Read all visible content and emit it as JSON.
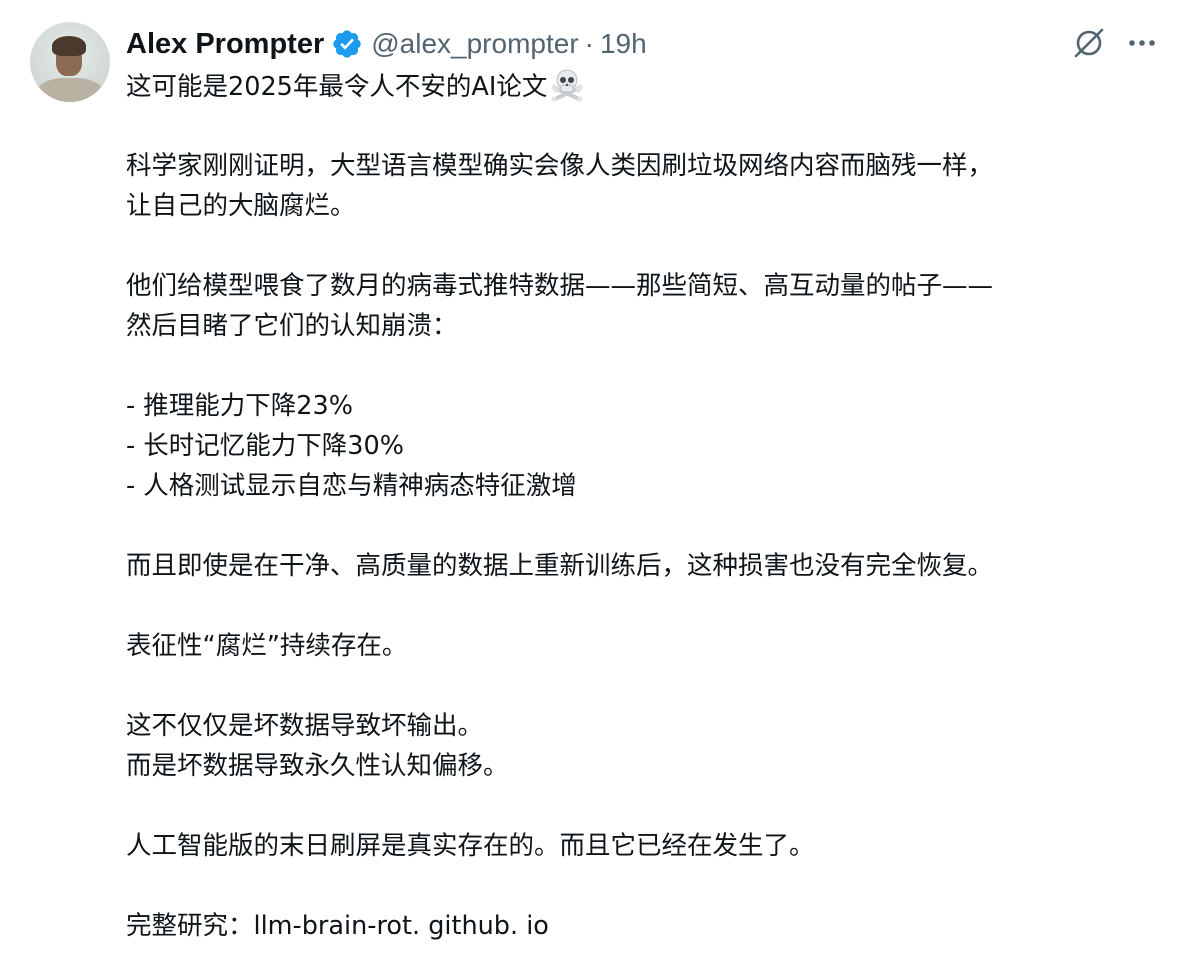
{
  "author": {
    "name": "Alex Prompter",
    "handle": "@alex_prompter",
    "separator": "·",
    "time": "19h"
  },
  "icons": {
    "avatar": "avatar",
    "verified": "verified-badge-icon",
    "grok": "grok-icon",
    "more": "more-options-icon",
    "skull": "skull-crossbones-emoji"
  },
  "colors": {
    "verified": "#1d9bf0",
    "text": "#0f1419",
    "secondary": "#536471"
  },
  "tweet": {
    "title": "这可能是2025年最令人不安的AI论文",
    "p1_line1": "科学家刚刚证明，大型语言模型确实会像人类因刷垃圾网络内容而脑残一样，",
    "p1_line2": "让自己的大脑腐烂。",
    "p2_line1": "他们给模型喂食了数月的病毒式推特数据——那些简短、高互动量的帖子——",
    "p2_line2": "然后目睹了它们的认知崩溃：",
    "bullet1": "- 推理能力下降23%",
    "bullet2": "- 长时记忆能力下降30%",
    "bullet3": "- 人格测试显示自恋与精神病态特征激增",
    "p3": "而且即使是在干净、高质量的数据上重新训练后，这种损害也没有完全恢复。",
    "p4": "表征性“腐烂”持续存在。",
    "p5_line1": "这不仅仅是坏数据导致坏输出。",
    "p5_line2": "而是坏数据导致永久性认知偏移。",
    "p6": "人工智能版的末日刷屏是真实存在的。而且它已经在发生了。",
    "study_label": "完整研究：",
    "study_link": "llm-brain-rot. github. io"
  }
}
